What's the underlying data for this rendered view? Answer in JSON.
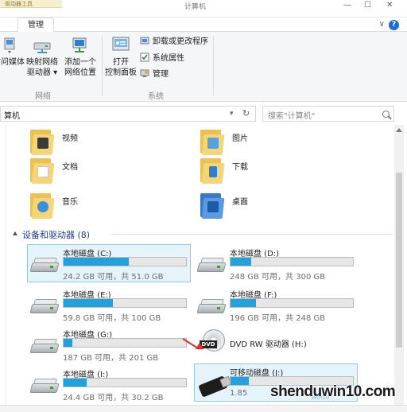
{
  "titlebar": {
    "context_tab_header": "驱动器工具",
    "title": "计算机",
    "controls": [
      "—",
      "☐",
      "✕"
    ]
  },
  "ribbon_tabs": {
    "manage": "管理",
    "minimize": "∨",
    "help": "?"
  },
  "ribbon": {
    "network_group": {
      "label": "网络",
      "access_media": "访问媒体",
      "map_drive_line1": "映射网络",
      "map_drive_line2": "驱动器 ▾",
      "add_location_line1": "添加一个",
      "add_location_line2": "网络位置"
    },
    "system_group": {
      "label": "系统",
      "open_cp_line1": "打开",
      "open_cp_line2": "控制面板",
      "uninstall": "卸载或更改程序",
      "properties": "系统属性",
      "manage": "管理"
    }
  },
  "address": {
    "path": "算机",
    "dropdown": "▾",
    "refresh": "↻",
    "search_placeholder": "搜索\"计算机\""
  },
  "folders": [
    {
      "label": "视频",
      "icon": "video-folder-icon"
    },
    {
      "label": "图片",
      "icon": "pictures-folder-icon"
    },
    {
      "label": "文档",
      "icon": "documents-folder-icon"
    },
    {
      "label": "下载",
      "icon": "downloads-folder-icon"
    },
    {
      "label": "音乐",
      "icon": "music-folder-icon"
    },
    {
      "label": "桌面",
      "icon": "desktop-folder-icon"
    }
  ],
  "devices_section": {
    "title": "设备和驱动器 (8)"
  },
  "drives": [
    {
      "name": "本地磁盘 (C:)",
      "info": "24.2 GB 可用，共 51.0 GB",
      "used": 0.53,
      "selected": true
    },
    {
      "name": "本地磁盘 (D:)",
      "info": "248 GB 可用，共 300 GB",
      "used": 0.17,
      "selected": false
    },
    {
      "name": "本地磁盘 (E:)",
      "info": "59.8 GB 可用，共 100 GB",
      "used": 0.4,
      "selected": false
    },
    {
      "name": "本地磁盘 (F:)",
      "info": "196 GB 可用，共 248 GB",
      "used": 0.21,
      "selected": false
    },
    {
      "name": "本地磁盘 (G:)",
      "info": "187 GB 可用，共 201 GB",
      "used": 0.07,
      "selected": false
    },
    {
      "name": "DVD RW 驱动器 (H:)",
      "info": "",
      "used": null,
      "selected": false
    },
    {
      "name": "本地磁盘 (I:)",
      "info": "24.4 GB 可用，共 30.2 GB",
      "used": 0.19,
      "selected": false
    },
    {
      "name": "可移动磁盘 (J:)",
      "info": "1.85",
      "used": 0.15,
      "selected": true
    }
  ],
  "dvd_icon_label": "DVD",
  "watermark": {
    "text": "shenduwin10.com",
    "sub": "Win10"
  },
  "colors": {
    "accent": "#26a0da",
    "selection_bg": "#e5f3fb",
    "section_title": "#1e3d8a",
    "arrow": "#d8322a"
  }
}
